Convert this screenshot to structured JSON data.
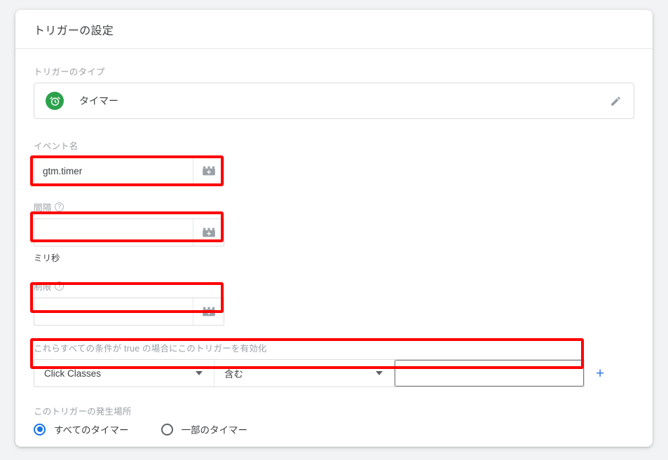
{
  "card": {
    "title": "トリガーの設定"
  },
  "trigger_type": {
    "label": "トリガーのタイプ",
    "icon": "alarm-clock-icon",
    "icon_color": "#2ca14c",
    "name": "タイマー",
    "edit_icon": "pencil-icon"
  },
  "event_name": {
    "label": "イベント名",
    "value": "gtm.timer",
    "placeholder": "",
    "variable_icon": "variable-block-plus-icon",
    "highlighted": true
  },
  "interval": {
    "label": "間隔",
    "help_icon": "help-circle-icon",
    "value": "",
    "placeholder": "",
    "variable_icon": "variable-block-plus-icon",
    "hint": "ミリ秒",
    "highlighted": true
  },
  "limit": {
    "label": "制限",
    "help_icon": "help-circle-icon",
    "value": "",
    "placeholder": "",
    "variable_icon": "variable-block-plus-icon",
    "highlighted": true
  },
  "conditions": {
    "label": "これらすべての条件が true の場合にこのトリガーを有効化",
    "variable_select": "Click Classes",
    "operator_select": "含む",
    "value": "",
    "value_placeholder": "",
    "add_label": "+",
    "add_color": "#3b78e7",
    "highlighted": true
  },
  "fire_on": {
    "label": "このトリガーの発生場所",
    "options": [
      {
        "label": "すべてのタイマー",
        "selected": true
      },
      {
        "label": "一部のタイマー",
        "selected": false
      }
    ],
    "selected_color": "#1a73e8"
  },
  "annotation": {
    "color": "#ff0000"
  }
}
